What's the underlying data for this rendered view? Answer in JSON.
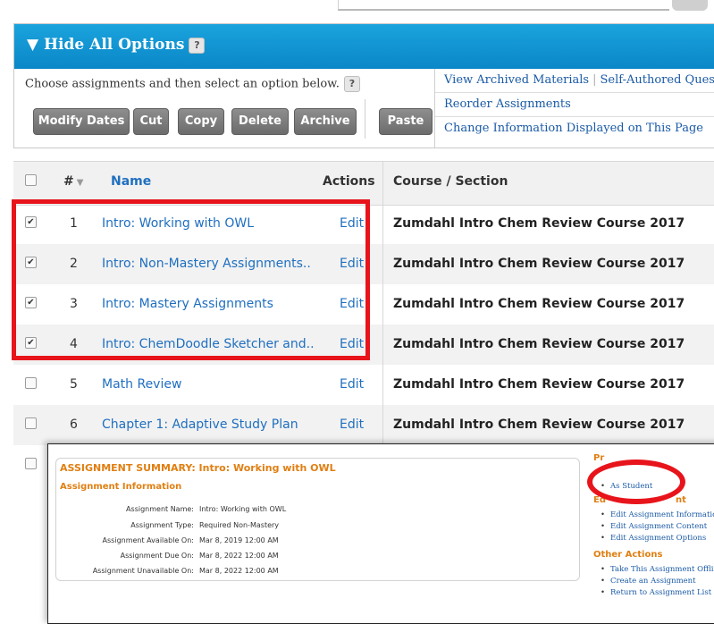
{
  "panel": {
    "title": "▼ Hide All Options",
    "help": "?",
    "choose_text": "Choose assignments and then select an option below.",
    "buttons": [
      "Modify Dates",
      "Cut",
      "Copy",
      "Delete",
      "Archive",
      "Paste"
    ],
    "links": {
      "row1_a": "View Archived Materials",
      "row1_sep": "|",
      "row1_b": "Self-Authored Ques",
      "row2": "Reorder Assignments",
      "row3": "Change Information Displayed on This Page"
    }
  },
  "table": {
    "headers": {
      "num": "#",
      "sort": "▼",
      "name": "Name",
      "actions": "Actions",
      "course": "Course / Section"
    },
    "rows": [
      {
        "num": "1",
        "name": "Intro: Working with OWL",
        "edit": "Edit",
        "course": "Zumdahl Intro Chem Review Course 2017",
        "checked": "✔"
      },
      {
        "num": "2",
        "name": "Intro: Non-Mastery Assignments..",
        "edit": "Edit",
        "course": "Zumdahl Intro Chem Review Course 2017",
        "checked": "✔"
      },
      {
        "num": "3",
        "name": "Intro: Mastery Assignments",
        "edit": "Edit",
        "course": "Zumdahl Intro Chem Review Course 2017",
        "checked": "✔"
      },
      {
        "num": "4",
        "name": "Intro: ChemDoodle Sketcher and..",
        "edit": "Edit",
        "course": "Zumdahl Intro Chem Review Course 2017",
        "checked": "✔"
      },
      {
        "num": "5",
        "name": "Math Review",
        "edit": "Edit",
        "course": "Zumdahl Intro Chem Review Course 2017",
        "checked": ""
      },
      {
        "num": "6",
        "name": "Chapter 1: Adaptive Study Plan",
        "edit": "Edit",
        "course": "Zumdahl Intro Chem Review Course 2017",
        "checked": ""
      }
    ]
  },
  "summary": {
    "title": "ASSIGNMENT SUMMARY: Intro: Working with OWL",
    "section": "Assignment Information",
    "fields": [
      {
        "label": "Assignment Name:",
        "value": "Intro: Working with OWL"
      },
      {
        "label": "Assignment Type:",
        "value": "Required  Non-Mastery"
      },
      {
        "label": "Assignment Available On:",
        "value": "Mar 8, 2019 12:00 AM"
      },
      {
        "label": "Assignment Due On:",
        "value": "Mar 8, 2022 12:00 AM"
      },
      {
        "label": "Assignment Unavailable On:",
        "value": "Mar 8, 2022 12:00 AM"
      }
    ],
    "side": {
      "preview_head": "Pr",
      "as_student": "As Student",
      "edit_head": "Ed",
      "edit_head_tail": "nt",
      "edit_links": [
        "Edit Assignment Information",
        "Edit Assignment Content",
        "Edit Assignment Options"
      ],
      "other_head": "Other Actions",
      "other_links": [
        "Take This Assignment Offline",
        "Create an Assignment",
        "Return to Assignment List"
      ]
    }
  },
  "colors": {
    "header_blue": "#0b87c7",
    "link_blue": "#1f6fc0",
    "highlight_red": "#e8141b",
    "summary_orange": "#e07f12"
  }
}
